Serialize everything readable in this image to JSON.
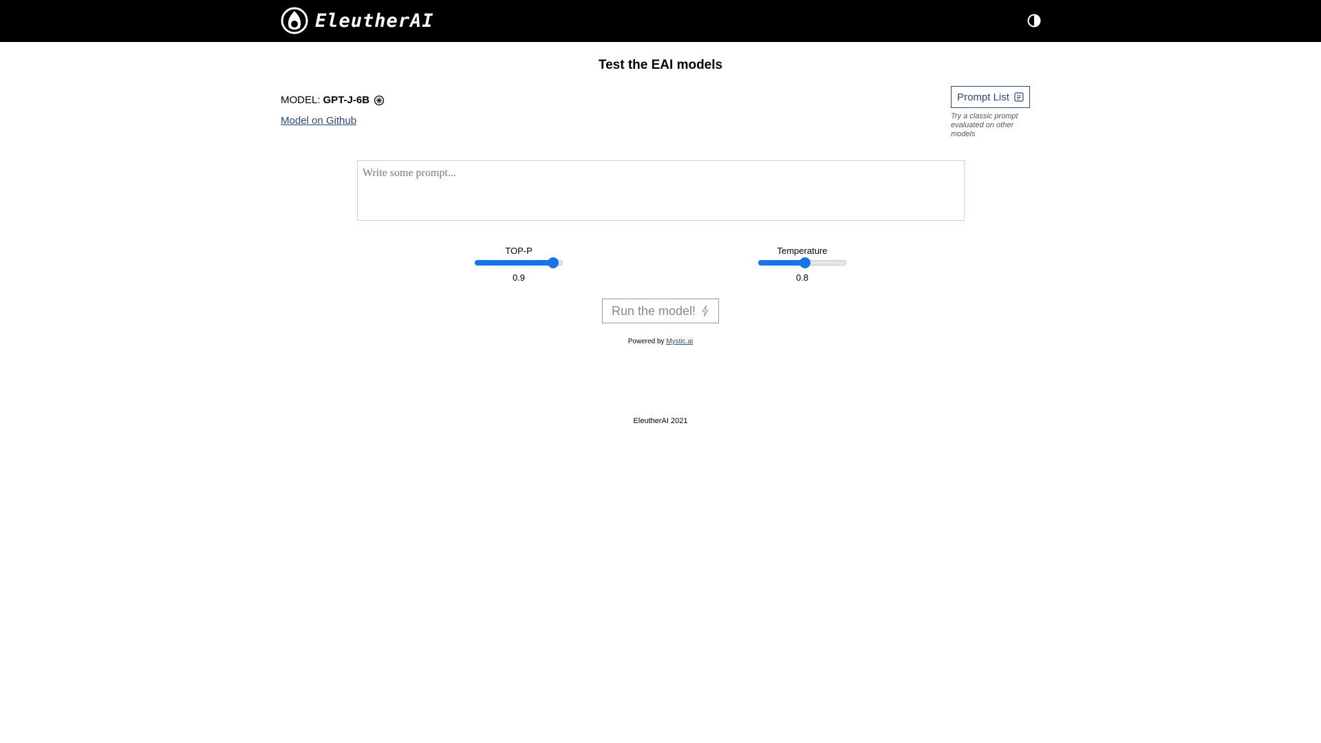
{
  "header": {
    "brand": "EleutherAI",
    "logo_icon": "eleutherai-logo-icon",
    "theme_icon": "contrast-toggle-icon"
  },
  "page": {
    "title": "Test the EAI models"
  },
  "model": {
    "label": "MODEL:",
    "name": "GPT-J-6B",
    "info_icon": "info-icon",
    "github_link": "Model on Github"
  },
  "prompt_list": {
    "button_label": "Prompt List",
    "icon": "list-icon",
    "hint": "Try a classic prompt evaluated on other models"
  },
  "prompt": {
    "placeholder": "Write some prompt...",
    "value": ""
  },
  "sliders": [
    {
      "label": "TOP-P",
      "value": "0.9",
      "fraction": 0.9
    },
    {
      "label": "Temperature",
      "value": "0.8",
      "fraction": 0.53
    }
  ],
  "run": {
    "label": "Run the model!",
    "icon": "lightning-icon"
  },
  "powered": {
    "prefix": "Powered by",
    "link": "Mystic.ai"
  },
  "footer": {
    "text": "EleutherAI 2021"
  },
  "colors": {
    "header_bg": "#000000",
    "accent": "#1a73e8",
    "link": "#2a4a7a"
  }
}
